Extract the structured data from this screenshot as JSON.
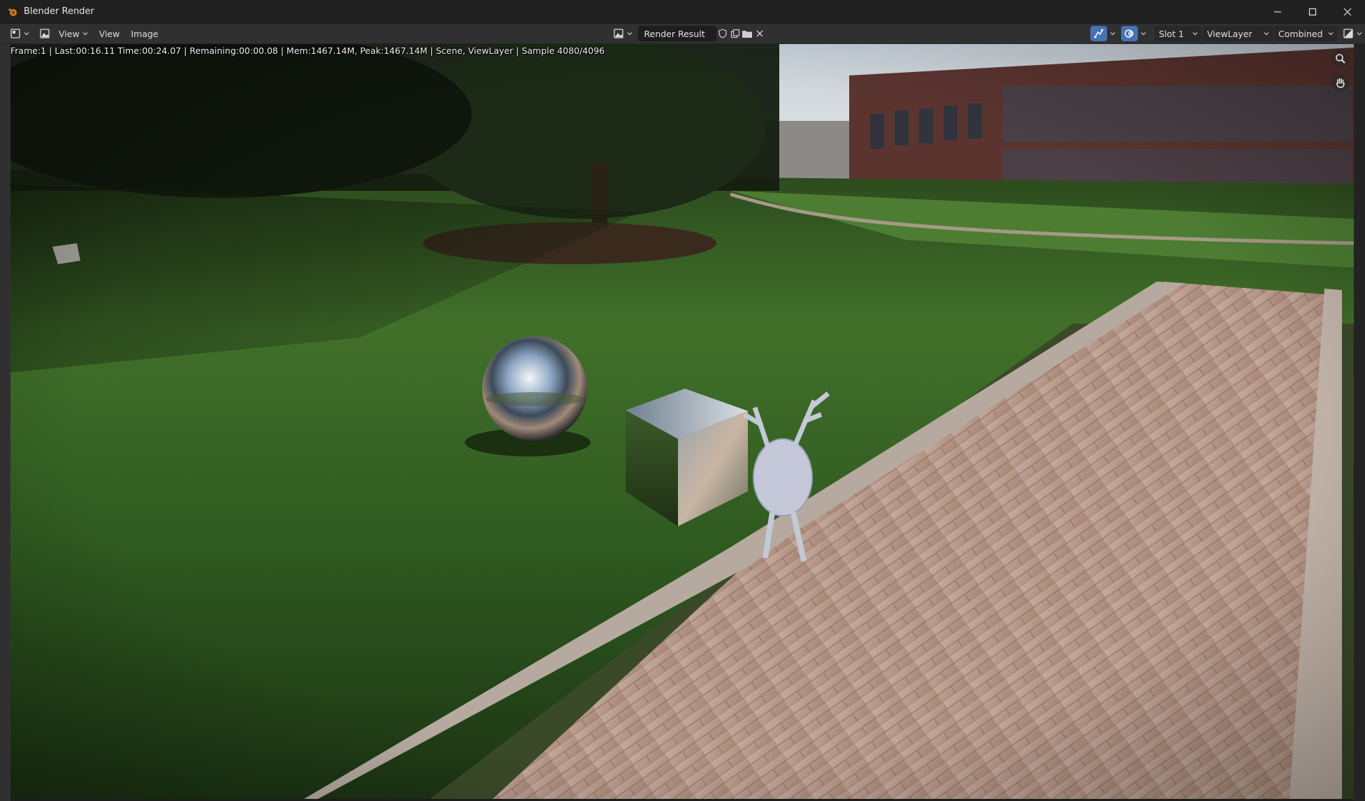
{
  "window": {
    "title": "Blender Render",
    "controls": {
      "minimize": "minimize-icon",
      "maximize": "maximize-icon",
      "close": "close-icon"
    }
  },
  "header": {
    "editor_type_icon": "image-editor-icon",
    "mode_icon": "image-mode-icon",
    "menu": {
      "view_dropdown": "View",
      "view": "View",
      "image": "Image"
    },
    "image_name": "Render Result",
    "image_actions": [
      "fake-user-shield-icon",
      "duplicate-image-icon",
      "browse-folder-icon",
      "unlink-x-icon"
    ],
    "right": {
      "gizmo_icon": "gizmo-toggle-icon",
      "overlay_icon": "overlay-toggle-icon",
      "slot": "Slot 1",
      "view_layer": "ViewLayer",
      "pass": "Combined",
      "display_channels_icon": "display-channels-icon"
    }
  },
  "render": {
    "status": "Frame:1 | Last:00:16.11 Time:00:24.07 | Remaining:00:00.08 | Mem:1467.14M, Peak:1467.14M | Scene, ViewLayer | Sample 4080/4096",
    "scene_objects": [
      "chrome-sphere",
      "mirror-cube",
      "deer-head-sculpture"
    ]
  },
  "colors": {
    "titlebar": "#202020",
    "header": "#303030",
    "accent": "#4772b3",
    "grass": "#3f6b24",
    "pavement": "#b89a86"
  }
}
